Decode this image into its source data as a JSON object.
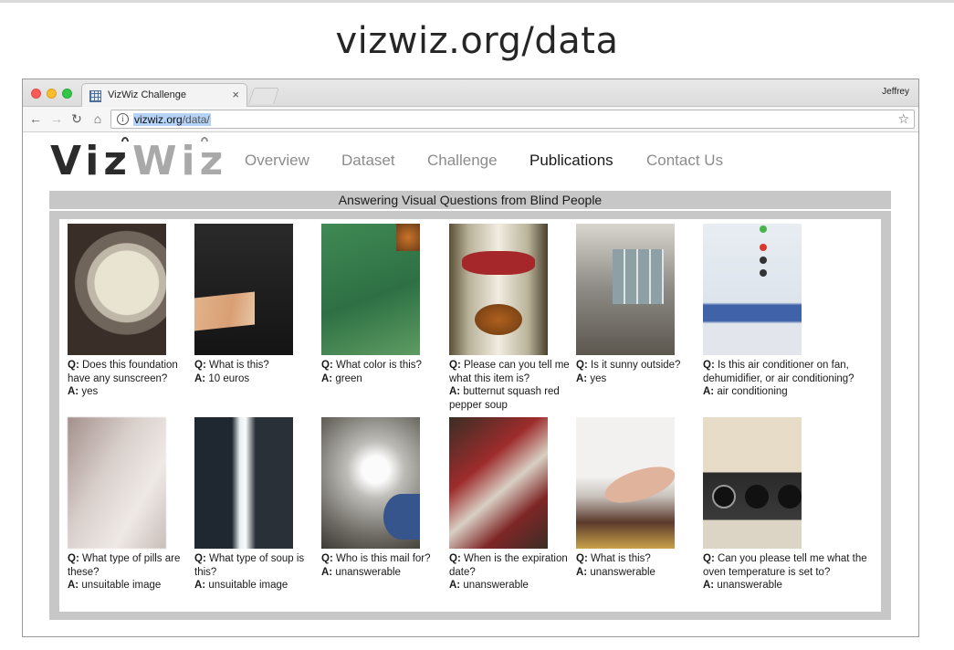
{
  "slide": {
    "title": "vizwiz.org/data"
  },
  "browser": {
    "tab_title": "VizWiz Challenge",
    "tab_close": "×",
    "profile_name": "Jeffrey",
    "url_host": "vizwiz.org",
    "url_path": "/data/",
    "icons": {
      "back": "←",
      "forward": "→",
      "reload": "↻",
      "home": "⌂",
      "info": "i",
      "star": "☆"
    }
  },
  "site": {
    "logo_dark": "Viz",
    "logo_light": "Wiz",
    "nav": [
      {
        "label": "Overview",
        "active": false
      },
      {
        "label": "Dataset",
        "active": false
      },
      {
        "label": "Challenge",
        "active": false
      },
      {
        "label": "Publications",
        "active": true
      },
      {
        "label": "Contact Us",
        "active": false
      }
    ],
    "banner": "Answering Visual Questions from Blind People",
    "q_prefix": "Q:",
    "a_prefix": "A:",
    "examples": [
      {
        "question": "Does this foundation have any sunscreen?",
        "answer": "yes"
      },
      {
        "question": "What is this?",
        "answer": "10 euros"
      },
      {
        "question": "What color is this?",
        "answer": "green"
      },
      {
        "question": "Please can you tell me what this item is?",
        "answer": "butternut squash red pepper soup"
      },
      {
        "question": "Is it sunny outside?",
        "answer": "yes"
      },
      {
        "question": "Is this air conditioner on fan, dehumidifier, or air conditioning?",
        "answer": "air conditioning"
      },
      {
        "question": "What type of pills are these?",
        "answer": "unsuitable image"
      },
      {
        "question": "What type of soup is this?",
        "answer": "unsuitable image"
      },
      {
        "question": "Who is this mail for?",
        "answer": "unanswerable"
      },
      {
        "question": "When is the expiration date?",
        "answer": "unanswerable"
      },
      {
        "question": "What is this?",
        "answer": "unanswerable"
      },
      {
        "question": "Can you please tell me what the oven temperature is set to?",
        "answer": "unanswerable"
      }
    ]
  }
}
